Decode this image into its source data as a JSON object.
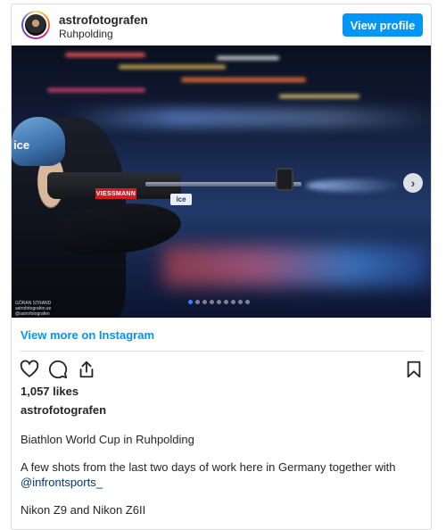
{
  "post": {
    "username": "astrofotografen",
    "location": "Ruhpolding",
    "view_profile_label": "View profile",
    "photo": {
      "helmet_text": "ice",
      "sponsor_text": "VIESSMANN",
      "ice_tag_text": "ice",
      "credit_lines": [
        "GÖRAN STRAND",
        "astrofotografen.se",
        "@astrofotografen"
      ],
      "carousel_total_dots": 9,
      "carousel_active_index": 0
    },
    "view_more_label": "View more on Instagram",
    "likes": "1,057 likes",
    "caption_username": "astrofotografen",
    "caption_line1": "Biathlon World Cup in Ruhpolding",
    "caption_line2": "A few shots from the last two days of work here in Germany together with",
    "caption_mention": "@infrontsports_",
    "caption_line3": "Nikon Z9 and Nikon Z6II"
  },
  "icons": {
    "like": "heart-icon",
    "comment": "comment-icon",
    "share": "share-icon",
    "save": "bookmark-icon",
    "next": "chevron-right-icon"
  },
  "colors": {
    "accent": "#0095f6",
    "text": "#262626",
    "border": "#dbdbdb"
  }
}
